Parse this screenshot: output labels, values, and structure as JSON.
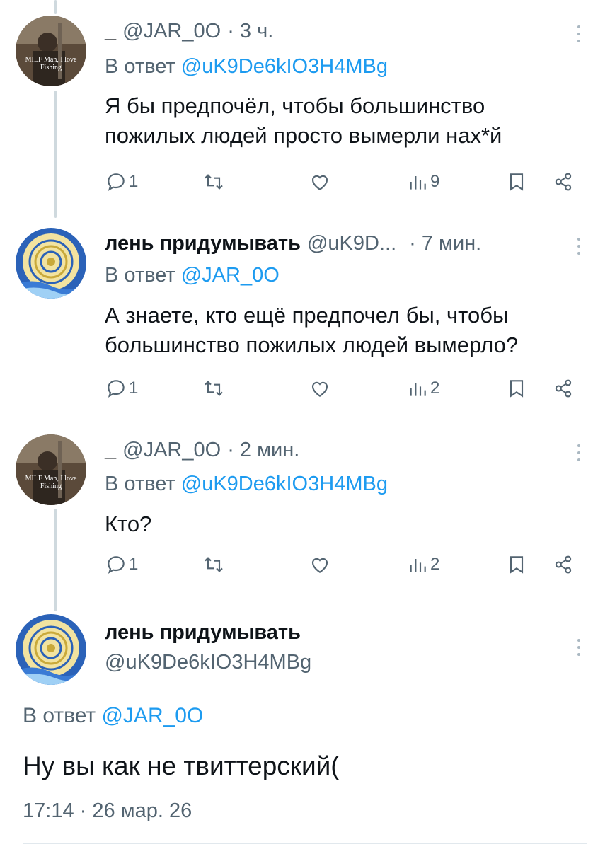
{
  "replies": [
    {
      "display_name": "_",
      "handle": "@JAR_0O",
      "time": "· 3 ч.",
      "reply_label": "В ответ",
      "reply_to": "@uK9De6kIO3H4MBg",
      "text": "Я бы предпочёл, чтобы большинство пожилых людей просто вымерли нах*й",
      "reply_count": "1",
      "views": "9",
      "avatar_text": "MILF Man, I love Fishing"
    },
    {
      "display_name": "лень придумывать",
      "handle": "@uK9D...",
      "time": "· 7 мин.",
      "reply_label": "В ответ",
      "reply_to": "@JAR_0O",
      "text": "А знаете, кто ещё предпочел бы, чтобы большинство пожилых людей вымерло?",
      "reply_count": "1",
      "views": "2"
    },
    {
      "display_name": "_",
      "handle": "@JAR_0O",
      "time": "· 2 мин.",
      "reply_label": "В ответ",
      "reply_to": "@uK9De6kIO3H4MBg",
      "text": "Кто?",
      "reply_count": "1",
      "views": "2",
      "avatar_text": "MILF Man, I love Fishing"
    }
  ],
  "main_tweet": {
    "display_name": "лень придумывать",
    "handle": "@uK9De6kIO3H4MBg",
    "reply_label": "В ответ",
    "reply_to": "@JAR_0O",
    "text": "Ну вы как не твиттерский(",
    "timestamp": "17:14 · 26 мар. 26"
  },
  "icons": {
    "reply": "reply-icon",
    "retweet": "retweet-icon",
    "like": "like-icon",
    "views": "views-icon",
    "bookmark": "bookmark-icon",
    "share": "share-icon",
    "more": "more-vertical-icon"
  },
  "colors": {
    "accent": "#1d9bf0",
    "text": "#0f1419",
    "secondary": "#536471",
    "thread_line": "#cfd9de"
  }
}
